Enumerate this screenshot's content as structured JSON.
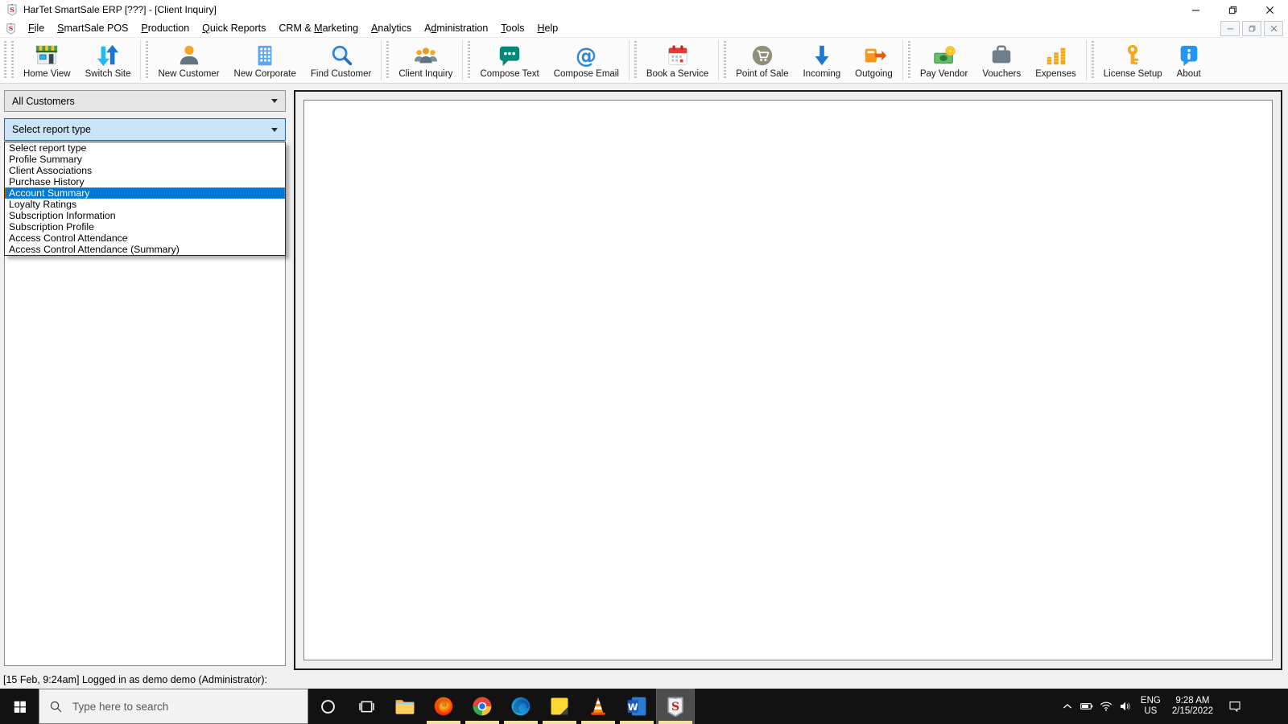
{
  "colors": {
    "accent": "#0078d7",
    "selection_bg": "#0078d7",
    "selection_text": "#ffffff",
    "combo_focus_bg": "#cce4f7",
    "taskbar_bg": "#121212",
    "running_indicator": "#efe2a4"
  },
  "window": {
    "title": "HarTet SmartSale ERP [???] - [Client Inquiry]",
    "app_icon": "smartsale-logo-icon",
    "controls": [
      {
        "name": "minimize-button",
        "icon": "minimize-icon"
      },
      {
        "name": "restore-button",
        "icon": "restore-icon"
      },
      {
        "name": "close-button",
        "icon": "close-icon"
      }
    ]
  },
  "menu_bar": {
    "items": [
      {
        "label": "File",
        "u": 0
      },
      {
        "label": "SmartSale POS",
        "u": 0
      },
      {
        "label": "Production",
        "u": 0
      },
      {
        "label": "Quick Reports",
        "u": 0
      },
      {
        "label": "CRM & Marketing",
        "u": 6
      },
      {
        "label": "Analytics",
        "u": 0
      },
      {
        "label": "Administration",
        "u": 1
      },
      {
        "label": "Tools",
        "u": 0
      },
      {
        "label": "Help",
        "u": 0
      }
    ],
    "mdi_controls": [
      {
        "name": "mdi-minimize-button",
        "icon": "minimize-icon"
      },
      {
        "name": "mdi-restore-button",
        "icon": "restore-icon"
      },
      {
        "name": "mdi-close-button",
        "icon": "close-icon"
      }
    ]
  },
  "toolbar": {
    "groups": [
      {
        "buttons": [
          {
            "label": "Home View",
            "icon": "store-icon"
          },
          {
            "label": "Switch Site",
            "icon": "switch-arrows-icon"
          }
        ]
      },
      {
        "buttons": [
          {
            "label": "New Customer",
            "icon": "person-icon"
          },
          {
            "label": "New Corporate",
            "icon": "building-icon"
          },
          {
            "label": "Find Customer",
            "icon": "magnifier-icon"
          }
        ]
      },
      {
        "buttons": [
          {
            "label": "Client Inquiry",
            "icon": "people-group-icon"
          }
        ]
      },
      {
        "buttons": [
          {
            "label": "Compose Text",
            "icon": "chat-bubble-icon"
          },
          {
            "label": "Compose Email",
            "icon": "at-icon"
          }
        ]
      },
      {
        "buttons": [
          {
            "label": "Book a Service",
            "icon": "calendar-icon"
          }
        ]
      },
      {
        "buttons": [
          {
            "label": "Point of Sale",
            "icon": "cart-icon"
          },
          {
            "label": "Incoming",
            "icon": "arrow-down-icon"
          },
          {
            "label": "Outgoing",
            "icon": "arrow-out-icon"
          }
        ]
      },
      {
        "buttons": [
          {
            "label": "Pay Vendor",
            "icon": "money-icon"
          },
          {
            "label": "Vouchers",
            "icon": "briefcase-icon"
          },
          {
            "label": "Expenses",
            "icon": "coin-stacks-icon"
          }
        ]
      },
      {
        "buttons": [
          {
            "label": "License Setup",
            "icon": "key-icon"
          },
          {
            "label": "About",
            "icon": "info-icon"
          }
        ]
      }
    ]
  },
  "left_panel": {
    "customer_filter": {
      "value": "All Customers"
    },
    "report_type": {
      "value": "Select report type"
    },
    "report_dropdown": {
      "selected_index": 4,
      "items": [
        "Select report type",
        "Profile Summary",
        "Client Associations",
        "Purchase History",
        "Account Summary",
        "Loyalty Ratings",
        "Subscription Information",
        "Subscription Profile",
        "Access Control Attendance",
        "Access Control Attendance (Summary)"
      ]
    }
  },
  "status_bar": {
    "text": "[15 Feb, 9:24am] Logged in as demo demo (Administrator):"
  },
  "taskbar": {
    "search": {
      "placeholder": "Type here to search"
    },
    "system_buttons": [
      {
        "name": "cortana-button",
        "icon": "cortana-icon"
      },
      {
        "name": "task-view-button",
        "icon": "task-view-icon"
      }
    ],
    "apps": [
      {
        "name": "file-explorer",
        "running": false,
        "active": false
      },
      {
        "name": "firefox",
        "running": true,
        "active": false
      },
      {
        "name": "chrome",
        "running": true,
        "active": false
      },
      {
        "name": "edge",
        "running": true,
        "active": false
      },
      {
        "name": "sticky-notes",
        "running": true,
        "active": false
      },
      {
        "name": "vlc",
        "running": true,
        "active": false
      },
      {
        "name": "word",
        "running": true,
        "active": false
      },
      {
        "name": "smartsale",
        "running": true,
        "active": true
      }
    ],
    "tray": {
      "language": "ENG",
      "region": "US",
      "time": "9:28 AM",
      "date": "2/15/2022"
    }
  }
}
